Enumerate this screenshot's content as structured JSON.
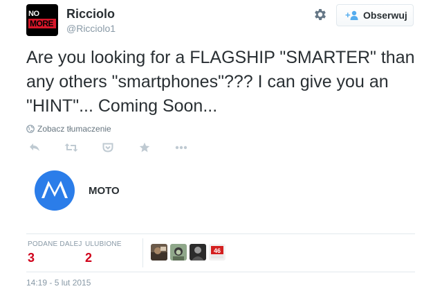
{
  "user": {
    "display_name": "Ricciolo",
    "handle": "@Ricciolo1",
    "avatar_text": [
      "NO",
      "MORE"
    ]
  },
  "follow_button": {
    "label": "Obserwuj"
  },
  "tweet": {
    "text": "Are you looking for a FLAGSHIP \"SMARTER\" than any others \"smartphones\"??? I can give you an \"HINT\"... Coming Soon...",
    "translate_link": "Zobacz tłumaczenie"
  },
  "actions": [
    "reply-icon",
    "retweet-icon",
    "pocket-icon",
    "favorite-icon",
    "more-icon"
  ],
  "card": {
    "title": "MOTO",
    "logo_color": "#2b7de9"
  },
  "stats": {
    "retweets_label": "PODANE DALEJ",
    "retweets_value": "3",
    "favorites_label": "ULUBIONE",
    "favorites_value": "2"
  },
  "favoriters": [
    "user-avatar-1",
    "user-avatar-2",
    "user-avatar-3",
    "user-avatar-4"
  ],
  "timestamp": "14:19 - 5 lut 2015",
  "colors": {
    "text": "#292f33",
    "muted": "#8899a6",
    "accent": "#2b7bb9",
    "stat_value": "#d0021b"
  }
}
